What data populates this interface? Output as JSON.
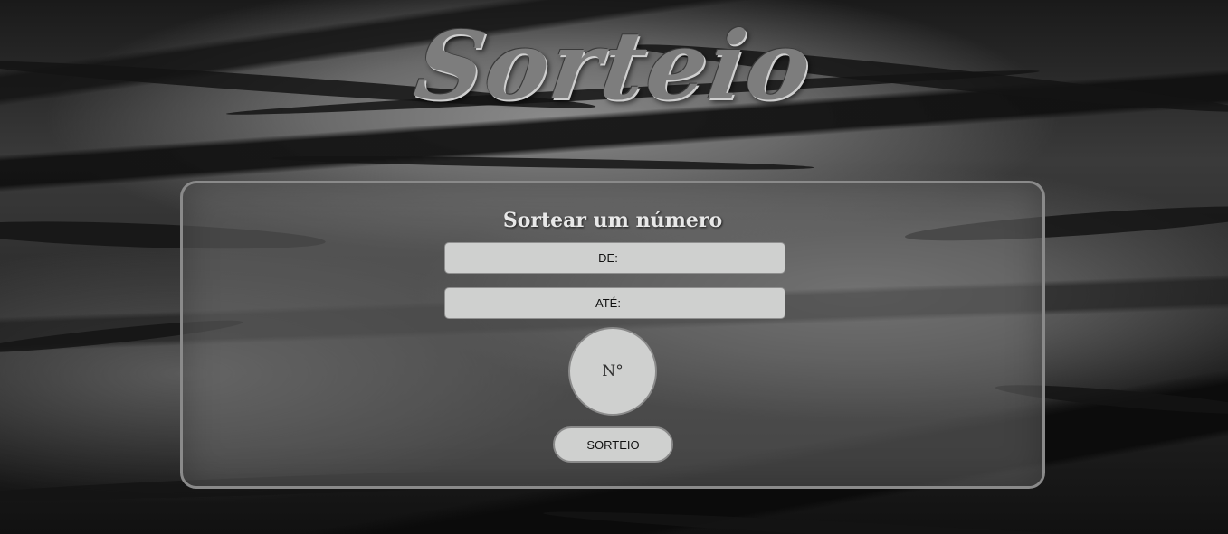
{
  "page": {
    "title": "Sorteio"
  },
  "panel": {
    "heading": "Sortear um número",
    "from_placeholder": "DE:",
    "to_placeholder": "ATÉ:",
    "from_value": "",
    "to_value": "",
    "result": "N°",
    "draw_label": "SORTEIO"
  },
  "colors": {
    "panel_border": "#8a8a8a",
    "control_fill": "#cfd0cf",
    "title_text": "#7d7d7d"
  }
}
